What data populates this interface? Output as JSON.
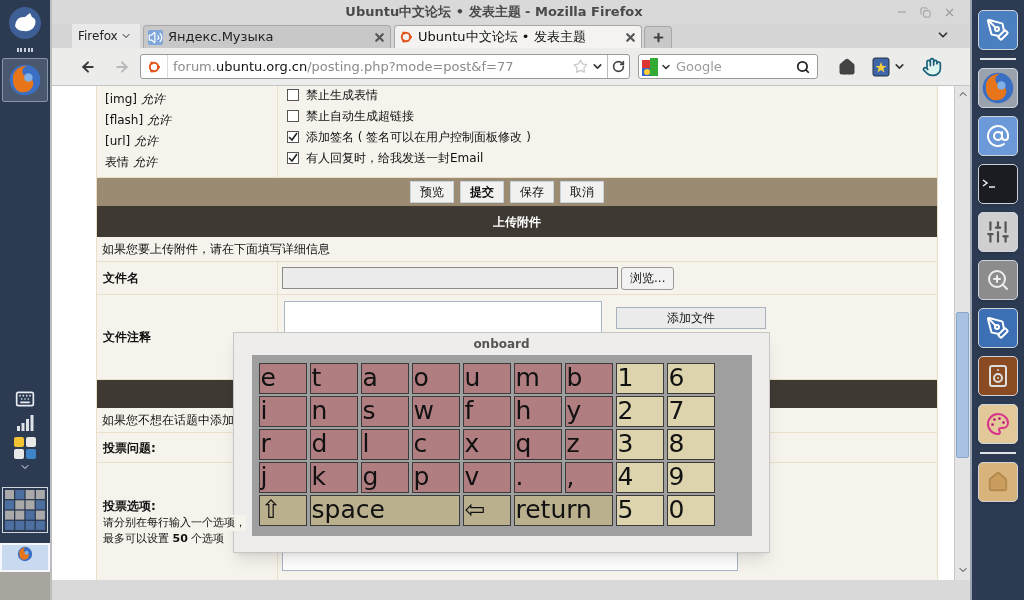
{
  "window": {
    "title": "Ubuntu中文论坛 • 发表主题 - Mozilla Firefox"
  },
  "browser": {
    "menu_button": "Firefox",
    "tabs": [
      {
        "title": "Яндекс.Музыка",
        "kind": "audio",
        "selected": false
      },
      {
        "title": "Ubuntu中文论坛 • 发表主题",
        "kind": "site",
        "selected": true
      }
    ],
    "forward": {
      "disabled": true
    },
    "address": {
      "prefix": "forum.",
      "domain": "ubuntu.org.cn",
      "path": "/posting.php?mode=post&f=77"
    },
    "search": {
      "placeholder": "Google"
    }
  },
  "options": {
    "permissions": [
      "[img] *允许*",
      "[flash] *允许*",
      "[url] *允许*",
      "表情 *允许*"
    ],
    "checkboxes": [
      {
        "label": "禁止生成表情",
        "checked": false
      },
      {
        "label": "禁止自动生成超链接",
        "checked": false
      },
      {
        "label": "添加签名 ( 签名可以在用户控制面板修改 )",
        "checked": true
      },
      {
        "label": "有人回复时，给我发送一封Email",
        "checked": true
      }
    ]
  },
  "actions": [
    {
      "label": "预览",
      "primary": false
    },
    {
      "label": "提交",
      "primary": true
    },
    {
      "label": "保存",
      "primary": false
    },
    {
      "label": "取消",
      "primary": false
    }
  ],
  "attachments": {
    "header": "上传附件",
    "note": "如果您要上传附件，请在下面填写详细信息",
    "file_label": "文件名",
    "browse_button": "浏览...",
    "comment_label": "文件注释",
    "add_button": "添加文件"
  },
  "poll": {
    "note": "如果您不想在话题中添加",
    "question_label": "投票问题:",
    "options_label": "投票选项:",
    "options_hint": [
      "请分别在每行输入一个选项，",
      "最多可以设置 **50** 个选项"
    ]
  },
  "keyboard": {
    "title": "onboard",
    "letter_rows": [
      [
        "e",
        "t",
        "a",
        "o",
        "u",
        "m",
        "b"
      ],
      [
        "i",
        "n",
        "s",
        "w",
        "f",
        "h",
        "y"
      ],
      [
        "r",
        "d",
        "l",
        "c",
        "x",
        "q",
        "z"
      ],
      [
        "j",
        "k",
        "g",
        "p",
        "v",
        ".",
        ","
      ]
    ],
    "function_keys": [
      {
        "label": "⇧",
        "kind": "shift"
      },
      {
        "label": "space",
        "kind": "space"
      },
      {
        "label": "⇦",
        "kind": "backspace"
      },
      {
        "label": "return",
        "kind": "return"
      }
    ],
    "digit_rows": [
      [
        "1",
        "6"
      ],
      [
        "2",
        "7"
      ],
      [
        "3",
        "8"
      ],
      [
        "4",
        "9"
      ],
      [
        "5",
        "0"
      ]
    ]
  }
}
